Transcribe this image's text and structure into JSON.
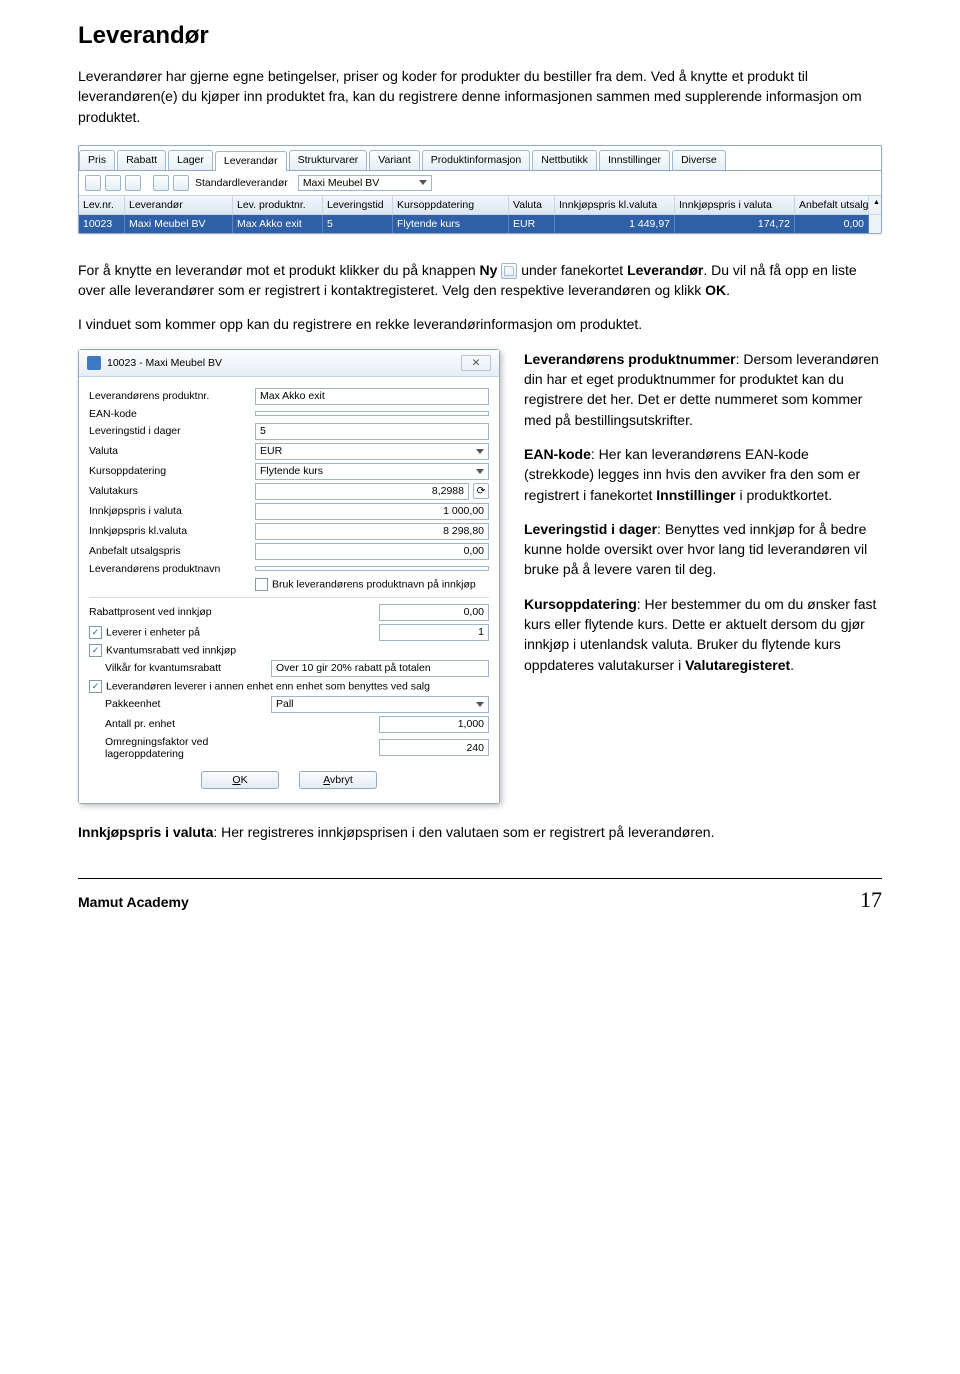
{
  "heading": "Leverandør",
  "intro": "Leverandører har gjerne egne betingelser, priser og koder for produkter du bestiller fra dem. Ved å knytte et produkt til leverandøren(e) du kjøper inn produktet fra, kan du registrere denne informasjonen sammen med supplerende informasjon om produktet.",
  "panel": {
    "tabs": [
      "Pris",
      "Rabatt",
      "Lager",
      "Leverandør",
      "Strukturvarer",
      "Variant",
      "Produktinformasjon",
      "Nettbutikk",
      "Innstillinger",
      "Diverse"
    ],
    "active_tab": 3,
    "std_label": "Standardleverandør",
    "std_value": "Maxi Meubel BV",
    "headers": [
      "Lev.nr.",
      "Leverandør",
      "Lev. produktnr.",
      "Leveringstid",
      "Kursoppdatering",
      "Valuta",
      "Innkjøpspris kl.valuta",
      "Innkjøpspris i valuta",
      "Anbefalt utsalgspris"
    ],
    "row": [
      "10023",
      "Maxi Meubel BV",
      "Max Akko exit",
      "5",
      "Flytende kurs",
      "EUR",
      "1 449,97",
      "174,72",
      "0,00"
    ]
  },
  "mid_paragraph": {
    "p1a": "For å knytte en leverandør mot et produkt klikker du på knappen ",
    "p1_ny": "Ny",
    "p1b": " under fanekortet ",
    "p1_lev": "Leverandør",
    "p1c": ". Du vil nå få opp en liste over alle leverandører som er registrert i kontaktregisteret. Velg den respektive leverandøren og klikk ",
    "p1_ok": "OK",
    "p1d": ".",
    "p2": "I vinduet som kommer opp kan du registrere en rekke leverandørinformasjon om produktet."
  },
  "dialog": {
    "title": "10023 - Maxi Meubel BV",
    "rows": [
      {
        "label": "Leverandørens produktnr.",
        "value": "Max Akko exit",
        "type": "text"
      },
      {
        "label": "EAN-kode",
        "value": "",
        "type": "text"
      },
      {
        "label": "Leveringstid i dager",
        "value": "5",
        "type": "text"
      },
      {
        "label": "Valuta",
        "value": "EUR",
        "type": "select"
      },
      {
        "label": "Kursoppdatering",
        "value": "Flytende kurs",
        "type": "select"
      },
      {
        "label": "Valutakurs",
        "value": "8,2988",
        "type": "text-r",
        "refresh": true
      },
      {
        "label": "Innkjøpspris i valuta",
        "value": "1 000,00",
        "type": "text-r"
      },
      {
        "label": "Innkjøpspris kl.valuta",
        "value": "8 298,80",
        "type": "text-r"
      },
      {
        "label": "Anbefalt utsalgspris",
        "value": "0,00",
        "type": "text-r"
      },
      {
        "label": "Leverandørens produktnavn",
        "value": "",
        "type": "text"
      }
    ],
    "chk_bruk": "Bruk leverandørens produktnavn på innkjøp",
    "rabatt_label": "Rabattprosent ved innkjøp",
    "rabatt_value": "0,00",
    "chk_leverer": "Leverer i enheter på",
    "leverer_value": "1",
    "chk_kvantum": "Kvantumsrabatt ved innkjøp",
    "vilkaar_label": "Vilkår for kvantumsrabatt",
    "vilkaar_value": "Over 10 gir 20% rabatt på totalen",
    "chk_annen": "Leverandøren leverer i annen enhet enn enhet som benyttes ved salg",
    "pakke_label": "Pakkeenhet",
    "pakke_value": "Pall",
    "antall_label": "Antall pr. enhet",
    "antall_value": "1,000",
    "omregn_label": "Omregningsfaktor ved lageroppdatering",
    "omregn_value": "240",
    "ok": "OK",
    "avbryt": "Avbryt"
  },
  "right_text": {
    "t1_b": "Leverandørens produktnummer",
    "t1": ": Dersom leverandøren din har et eget produktnummer for produktet kan du registrere det her. Det er dette nummeret som kommer med på bestillingsutskrifter.",
    "t2_b": "EAN-kode",
    "t2a": ": Her kan leverandørens EAN-kode (strekkode) legges inn hvis den avviker fra den som er registrert i fanekortet ",
    "t2_b2": "Innstillinger",
    "t2b": " i produktkortet.",
    "t3_b": "Leveringstid i dager",
    "t3": ": Benyttes ved innkjøp for å bedre kunne holde oversikt over hvor lang tid leverandøren vil bruke på å levere varen til deg.",
    "t4_b": "Kursoppdatering",
    "t4a": ": Her bestemmer du om du ønsker fast kurs eller flytende kurs. Dette er aktuelt dersom du gjør innkjøp i utenlandsk valuta. Bruker du flytende kurs oppdateres valutakurser i ",
    "t4_b2": "Valutaregisteret",
    "t4b": "."
  },
  "bottom": {
    "b_b": "Innkjøpspris i valuta",
    "b": ": Her registreres innkjøpsprisen i den valutaen som er registrert på leverandøren."
  },
  "footer": {
    "brand": "Mamut Academy",
    "page": "17"
  }
}
